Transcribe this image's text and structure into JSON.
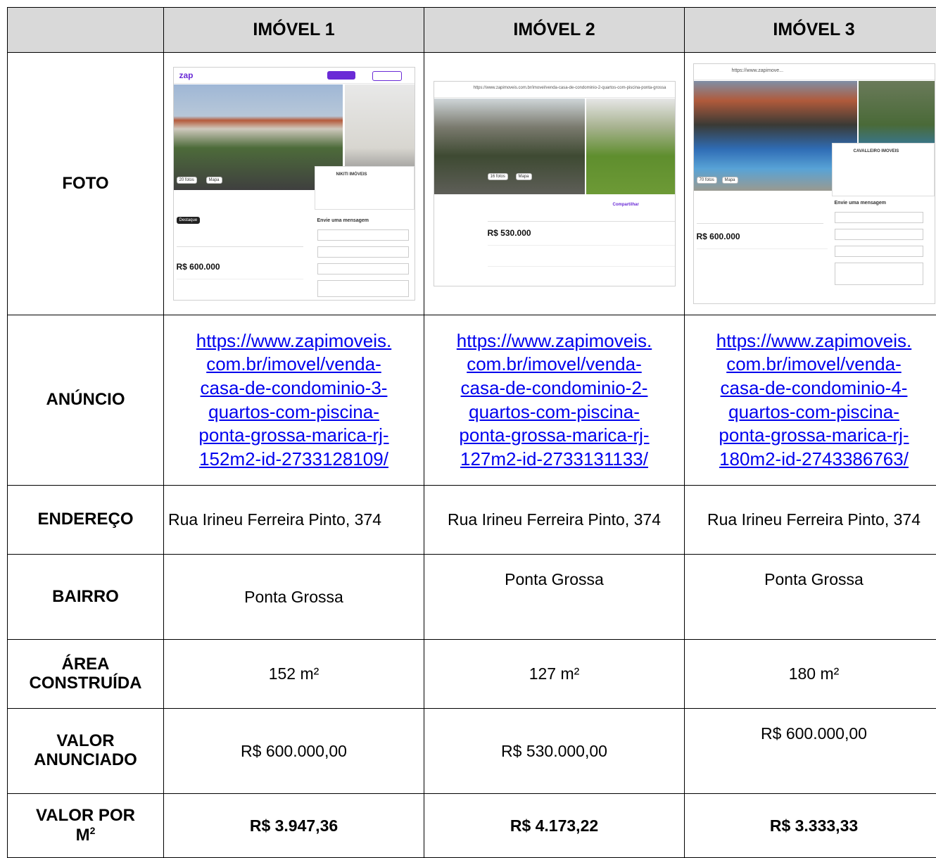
{
  "headers": [
    "",
    "IMÓVEL 1",
    "IMÓVEL 2",
    "IMÓVEL 3"
  ],
  "row_labels": {
    "foto": "FOTO",
    "anuncio": "ANÚNCIO",
    "endereco": "ENDEREÇO",
    "bairro": "BAIRRO",
    "area_l1": "ÁREA",
    "area_l2": "CONSTRUÍDA",
    "valor_l1": "VALOR",
    "valor_l2": "ANUNCIADO",
    "m2_l1": "VALOR POR",
    "m2_l2": "M",
    "m2_sup": "2"
  },
  "properties": [
    {
      "link_lines": [
        "https://www.zapimoveis.",
        "com.br/imovel/venda-",
        "casa-de-condominio-3-",
        "quartos-com-piscina-",
        "ponta-grossa-marica-rj-",
        "152m2-id-2733128109/"
      ],
      "endereco": "Rua Irineu Ferreira Pinto, 374",
      "bairro": "Ponta Grossa",
      "area": "152 m²",
      "valor": "R$ 600.000,00",
      "valor_m2": "R$ 3.947,36"
    },
    {
      "link_lines": [
        "https://www.zapimoveis.",
        "com.br/imovel/venda-",
        "casa-de-condominio-2-",
        "quartos-com-piscina-",
        "ponta-grossa-marica-rj-",
        "127m2-id-2733131133/"
      ],
      "endereco": "Rua Irineu Ferreira Pinto, 374",
      "bairro": "Ponta Grossa",
      "area": "127 m²",
      "valor": "R$ 530.000,00",
      "valor_m2": "R$ 4.173,22"
    },
    {
      "link_lines": [
        "https://www.zapimoveis.",
        "com.br/imovel/venda-",
        "casa-de-condominio-4-",
        "quartos-com-piscina-",
        "ponta-grossa-marica-rj-",
        "180m2-id-2743386763/"
      ],
      "endereco": "Rua Irineu Ferreira Pinto, 374",
      "bairro": "Ponta Grossa",
      "area": "180 m²",
      "valor": "R$ 600.000,00",
      "valor_m2": "R$ 3.333,33"
    }
  ],
  "screenshots": [
    {
      "brand": "zap",
      "agency": "NIKITI IMÓVEIS",
      "photos_count": "20 fotos",
      "map": "Mapa",
      "price": "R$ 600.000",
      "message": "Envie uma mensagem",
      "badge": "Destaque"
    },
    {
      "url": "https://www.zapimoveis.com.br/imovel/venda-casa-de-condominio-2-quartos-com-piscina-ponta-grossa",
      "photos_count": "16 fotos",
      "map": "Mapa",
      "price": "R$ 530.000",
      "share": "Compartilhar"
    },
    {
      "url": "https://www.zapimove...",
      "agency": "CAVALLEIRO IMOVEIS",
      "photos_count": "70 fotos",
      "map": "Mapa",
      "price": "R$ 600.000",
      "message": "Envie uma mensagem"
    }
  ]
}
